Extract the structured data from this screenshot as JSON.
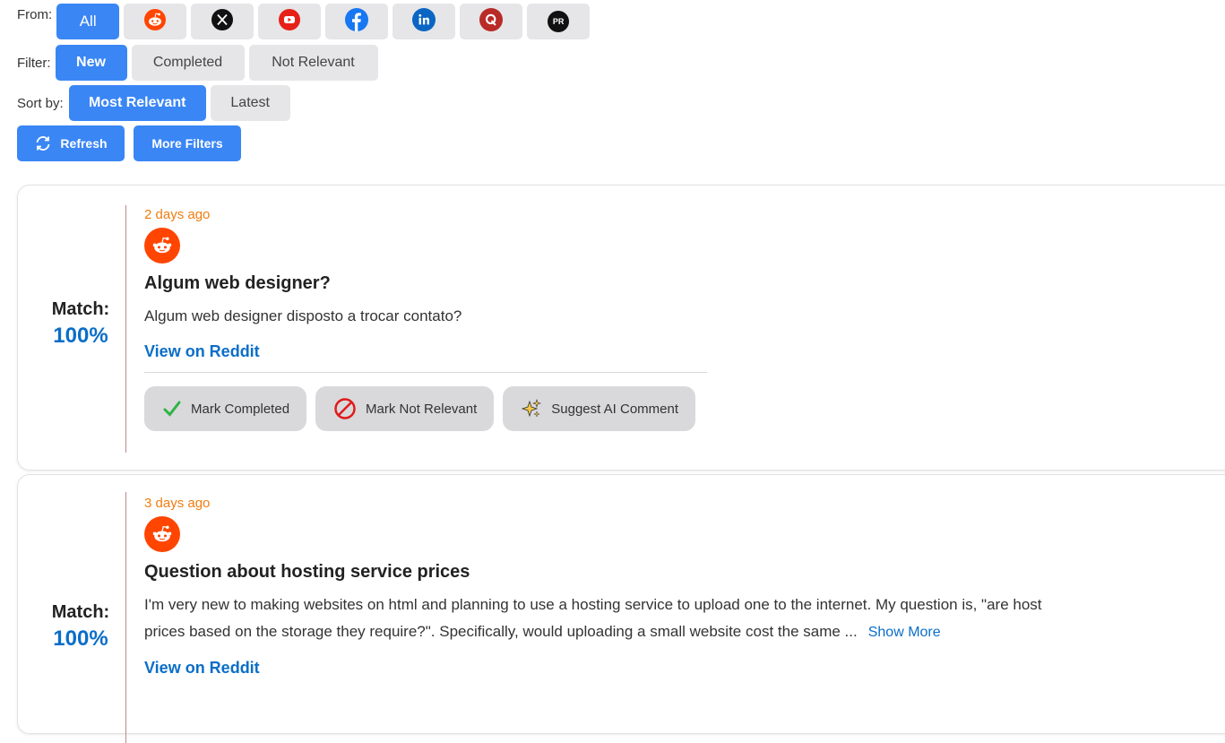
{
  "filters": {
    "from_label": "From:",
    "sources": [
      {
        "name": "all",
        "label": "All"
      },
      {
        "name": "reddit",
        "icon": "reddit-icon"
      },
      {
        "name": "x",
        "icon": "x-icon"
      },
      {
        "name": "youtube",
        "icon": "youtube-icon"
      },
      {
        "name": "facebook",
        "icon": "facebook-icon"
      },
      {
        "name": "linkedin",
        "icon": "linkedin-icon"
      },
      {
        "name": "quora",
        "icon": "quora-icon"
      },
      {
        "name": "pr",
        "label": "PR"
      }
    ],
    "filter_label": "Filter:",
    "filter_options": [
      "New",
      "Completed",
      "Not Relevant"
    ],
    "sort_label": "Sort by:",
    "sort_options": [
      "Most Relevant",
      "Latest"
    ],
    "refresh_label": "Refresh",
    "more_filters_label": "More Filters"
  },
  "colors": {
    "accent": "#3a86f5",
    "link": "#0a6ec8",
    "time": "#f07d10",
    "reddit": "#ff4500"
  },
  "posts": [
    {
      "match_label": "Match:",
      "match_value": "100%",
      "time": "2 days ago",
      "title": "Algum web designer?",
      "body": "Algum web designer disposto a trocar contato?",
      "link": "View on Reddit",
      "actions": [
        "Mark Completed",
        "Mark Not Relevant",
        "Suggest AI Comment"
      ]
    },
    {
      "match_label": "Match:",
      "match_value": "100%",
      "time": "3 days ago",
      "title": "Question about hosting service prices",
      "body_line1": "I'm very new to making websites on html and planning to use a hosting service to upload one to the internet. My question is, \"are host",
      "body_line2": "prices based on the storage they require?\". Specifically, would uploading a small website cost the same ...",
      "show_more": "Show More",
      "link": "View on Reddit"
    }
  ]
}
